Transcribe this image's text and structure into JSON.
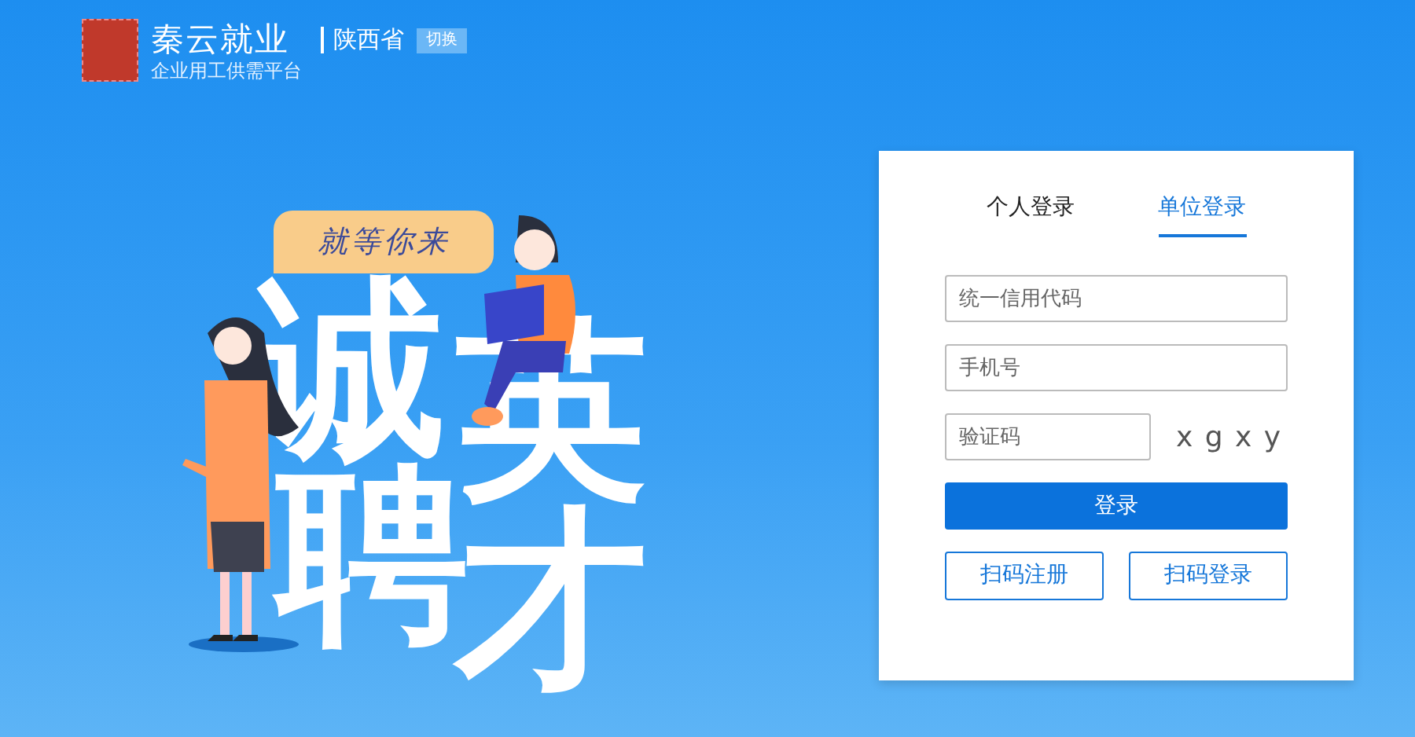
{
  "header": {
    "brand": "秦云就业",
    "subtitle": "企业用工供需平台",
    "region": "陕西省",
    "switch_label": "切换"
  },
  "hero": {
    "tagline": "就等你来",
    "headline": [
      "诚",
      "英",
      "聘",
      "才"
    ]
  },
  "login": {
    "tabs": [
      {
        "label": "个人登录",
        "selected": false
      },
      {
        "label": "单位登录",
        "selected": true
      }
    ],
    "fields": [
      {
        "placeholder": "统一信用代码"
      },
      {
        "placeholder": "手机号"
      }
    ],
    "captcha": {
      "placeholder": "验证码",
      "code": "x g x y"
    },
    "submit": "登录",
    "buttons": [
      "扫码注册",
      "扫码登录"
    ]
  }
}
